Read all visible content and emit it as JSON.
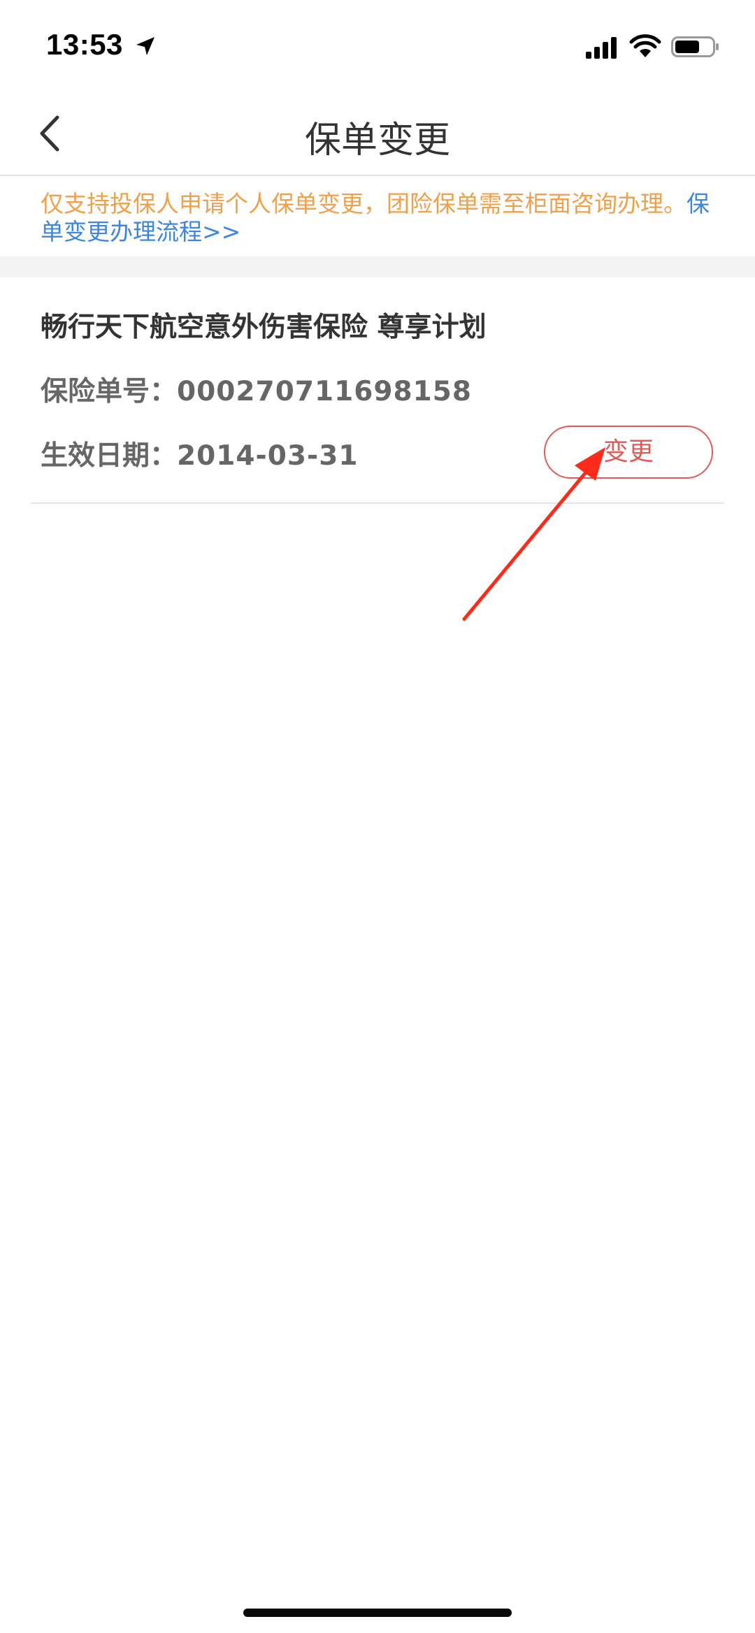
{
  "status_bar": {
    "time": "13:53",
    "icons": [
      "location-arrow-icon",
      "signal-icon",
      "wifi-icon",
      "battery-icon"
    ]
  },
  "nav": {
    "title": "保单变更",
    "back_icon": "chevron-left-icon"
  },
  "notice": {
    "text": "仅支持投保人申请个人保单变更，团险保单需至柜面咨询办理。",
    "link": "保单变更办理流程>>",
    "text_color": "#f0a04a",
    "link_color": "#3b86e0"
  },
  "policy": {
    "name": "畅行天下航空意外伤害保险 尊享计划",
    "number_label": "保险单号：",
    "number": "000270711698158",
    "date_label": "生效日期：",
    "date": "2014-03-31",
    "change_button": "变更",
    "accent_color": "#e05a57"
  },
  "annotation": {
    "type": "red-arrow",
    "color": "#ff2a1a"
  }
}
